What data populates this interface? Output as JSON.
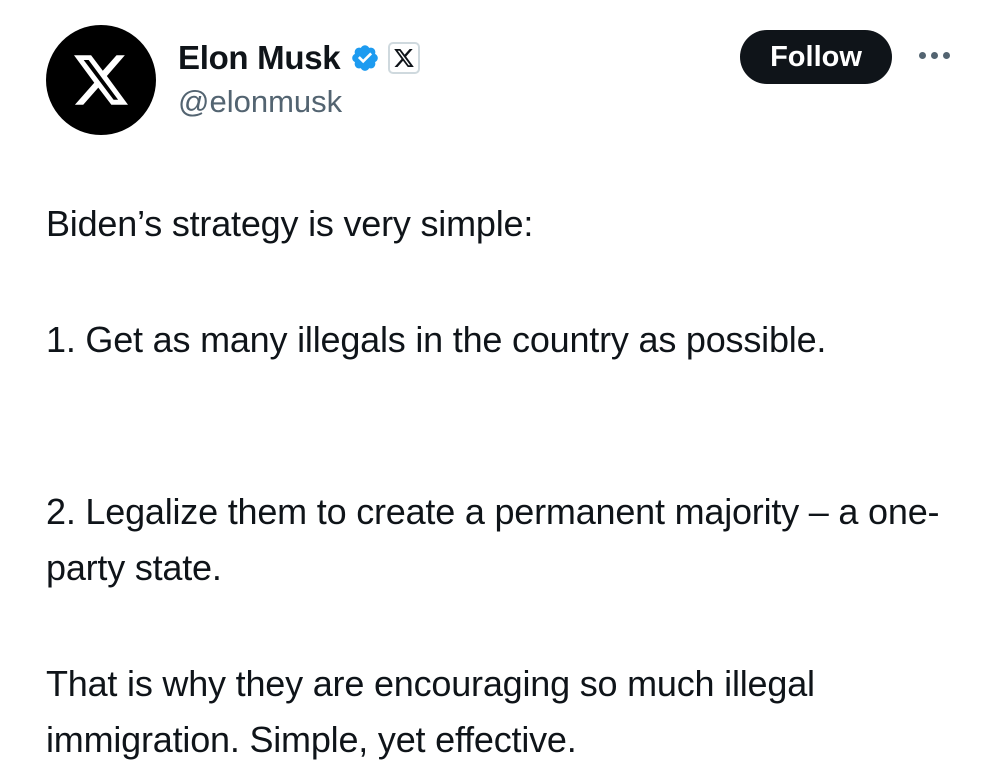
{
  "author": {
    "display_name": "Elon Musk",
    "handle": "@elonmusk",
    "avatar_icon": "x-logo-icon",
    "verified_icon": "verified-badge-icon",
    "affiliate_icon": "x-affiliate-badge-icon"
  },
  "actions": {
    "follow_label": "Follow",
    "more_icon": "more-dots-icon"
  },
  "tweet": {
    "paragraphs": [
      "Biden’s strategy is very simple:",
      "1. Get as many illegals in the country as possible.",
      "2. Legalize them to create a permanent majority – a one-party state.",
      "That is why they are encouraging so much illegal immigration. Simple, yet effective."
    ]
  },
  "colors": {
    "text_primary": "#0f1419",
    "text_secondary": "#536471",
    "verified_blue": "#1d9bf0",
    "follow_bg": "#0f1419",
    "follow_text": "#ffffff"
  }
}
